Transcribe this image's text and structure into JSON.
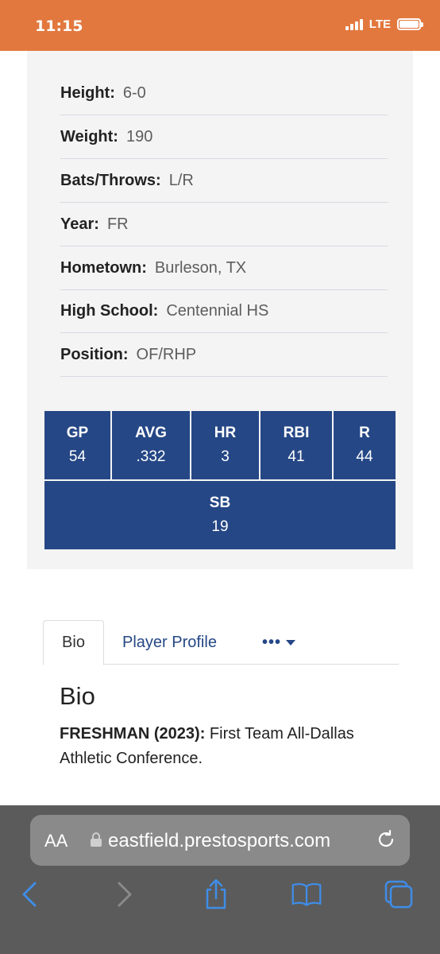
{
  "status_bar": {
    "time": "11:15",
    "network": "LTE"
  },
  "player_info": [
    {
      "label": "Height:",
      "value": "6-0"
    },
    {
      "label": "Weight:",
      "value": "190"
    },
    {
      "label": "Bats/Throws:",
      "value": "L/R"
    },
    {
      "label": "Year:",
      "value": "FR"
    },
    {
      "label": "Hometown:",
      "value": "Burleson, TX"
    },
    {
      "label": "High School:",
      "value": "Centennial HS"
    },
    {
      "label": "Position:",
      "value": "OF/RHP"
    }
  ],
  "stats": {
    "row1": [
      {
        "label": "GP",
        "value": "54"
      },
      {
        "label": "AVG",
        "value": ".332"
      },
      {
        "label": "HR",
        "value": "3"
      },
      {
        "label": "RBI",
        "value": "41"
      },
      {
        "label": "R",
        "value": "44"
      }
    ],
    "row2": [
      {
        "label": "SB",
        "value": "19"
      }
    ]
  },
  "tabs": {
    "bio": "Bio",
    "profile": "Player Profile",
    "more": "•••"
  },
  "bio": {
    "title": "Bio",
    "strong": "FRESHMAN (2023):",
    "text": " First Team All-Dallas Athletic Conference."
  },
  "browser": {
    "aa_label": "AA",
    "url": "eastfield.prestosports.com"
  },
  "icons": {
    "back": "chevron-left-icon",
    "forward": "chevron-right-icon",
    "share": "share-icon",
    "bookmarks": "book-icon",
    "tabs": "tabs-icon",
    "reload": "reload-icon",
    "lock": "lock-icon"
  },
  "colors": {
    "status_bar": "#e2783e",
    "stat_bg": "#254786",
    "link": "#254786",
    "browser_bg": "#5b5b5b",
    "toolbar_icon": "#3f8de8"
  }
}
